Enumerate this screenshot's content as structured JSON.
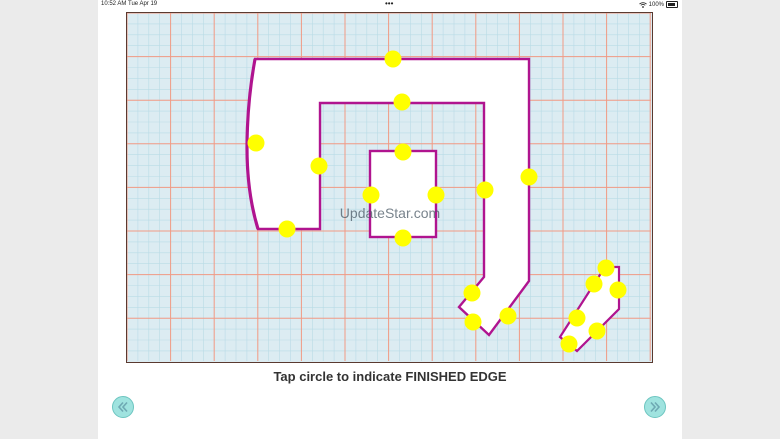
{
  "status_bar": {
    "time": "10:52 AM",
    "date": "Tue Apr 19",
    "dots": "•••",
    "battery": "100%"
  },
  "instruction": "Tap circle to indicate FINISHED EDGE",
  "watermark": "UpdateStar.com",
  "colors": {
    "grid_background": "#dcecf2",
    "grid_minor": "#b9dbe6",
    "grid_major": "#f29a84",
    "outline": "#b0148f",
    "shape_fill": "#ffffff",
    "edge_dot": "#ffff00",
    "nav_button": "#9fe3df"
  },
  "icons": {
    "prev": "chevron-left-double-icon",
    "next": "chevron-right-double-icon",
    "wifi": "wifi-icon",
    "battery": "battery-icon"
  }
}
